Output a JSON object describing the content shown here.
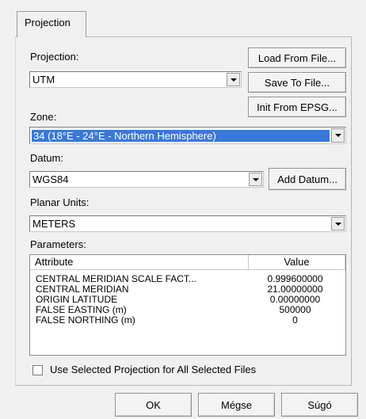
{
  "tab": {
    "label": "Projection"
  },
  "projection": {
    "label": "Projection:",
    "value": "UTM"
  },
  "buttons": {
    "load": "Load From File...",
    "save": "Save To File...",
    "init": "Init From EPSG...",
    "add_datum": "Add Datum..."
  },
  "zone": {
    "label": "Zone:",
    "value": "34 (18°E - 24°E - Northern Hemisphere)"
  },
  "datum": {
    "label": "Datum:",
    "value": "WGS84"
  },
  "planar_units": {
    "label": "Planar Units:",
    "value": "METERS"
  },
  "parameters": {
    "label": "Parameters:",
    "columns": [
      "Attribute",
      "Value"
    ],
    "rows": [
      {
        "attribute": "CENTRAL MERIDIAN SCALE FACT...",
        "value": "0.999600000"
      },
      {
        "attribute": "CENTRAL MERIDIAN",
        "value": "21.00000000"
      },
      {
        "attribute": "ORIGIN LATITUDE",
        "value": "0.00000000"
      },
      {
        "attribute": "FALSE EASTING (m)",
        "value": "500000"
      },
      {
        "attribute": "FALSE NORTHING (m)",
        "value": "0"
      }
    ]
  },
  "checkbox": {
    "label": "Use Selected Projection for All Selected Files",
    "checked": false
  },
  "footer": {
    "ok": "OK",
    "cancel": "Mégse",
    "help": "Súgó"
  }
}
